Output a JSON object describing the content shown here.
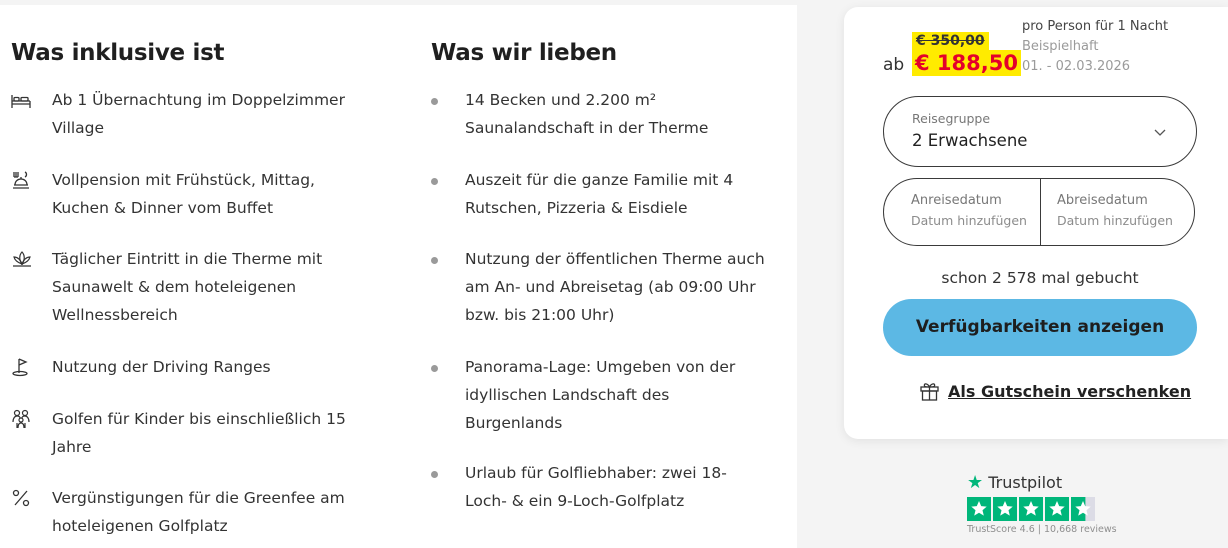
{
  "included": {
    "title": "Was inklusive ist",
    "items": [
      {
        "icon": "bed-icon",
        "text": "Ab 1 Übernachtung im Doppelzimmer Village"
      },
      {
        "icon": "buffet-icon",
        "text": "Vollpension mit Frühstück, Mittag, Kuchen & Dinner vom Buffet"
      },
      {
        "icon": "lotus-icon",
        "text": "Täglicher Eintritt in die Therme mit Saunawelt & dem hoteleigenen Wellnessbereich"
      },
      {
        "icon": "golf-flag-icon",
        "text": "Nutzung der Driving Ranges"
      },
      {
        "icon": "family-icon",
        "text": "Golfen für Kinder bis einschließlich 15 Jahre"
      },
      {
        "icon": "percent-icon",
        "text": "Vergünstigungen für die Greenfee am hoteleigenen Golfplatz"
      }
    ]
  },
  "loved": {
    "title": "Was wir lieben",
    "items": [
      {
        "text": "14 Becken und 2.200 m² Saunalandschaft in der Therme"
      },
      {
        "text": "Auszeit für die ganze Familie mit 4 Rutschen, Pizzeria & Eisdiele"
      },
      {
        "text": "Nutzung der öffentlichen Therme auch am An- und Abreisetag (ab 09:00 Uhr bzw. bis 21:00 Uhr)"
      },
      {
        "text": "Panorama-Lage: Umgeben von der idyllischen Landschaft des Burgenlands"
      },
      {
        "text": "Urlaub für Golfliebhaber: zwei 18-Loch- & ein 9-Loch-Golfplatz"
      }
    ]
  },
  "booking": {
    "ab_label": "ab",
    "old_price": "€ 350,00",
    "new_price": "€ 188,50",
    "per_person": "pro Person für 1 Nacht",
    "example": "Beispielhaft",
    "example_dates": "01. - 02.03.2026",
    "group_label": "Reisegruppe",
    "group_value": "2 Erwachsene",
    "arrival_label": "Anreisedatum",
    "arrival_placeholder": "Datum hinzufügen",
    "departure_label": "Abreisedatum",
    "departure_placeholder": "Datum hinzufügen",
    "booked_text": "schon 2 578 mal gebucht",
    "cta_label": "Verfügbarkeiten anzeigen",
    "gift_label": "Als Gutschein verschenken"
  },
  "trustpilot": {
    "brand": "Trustpilot",
    "score_text": "TrustScore 4.6 | 10,668 reviews",
    "rating": 4.6,
    "star_color": "#00b67a"
  },
  "colors": {
    "price_highlight": "#ffeb00",
    "price_red": "#e4002b",
    "cta_blue": "#5cb8e4"
  }
}
